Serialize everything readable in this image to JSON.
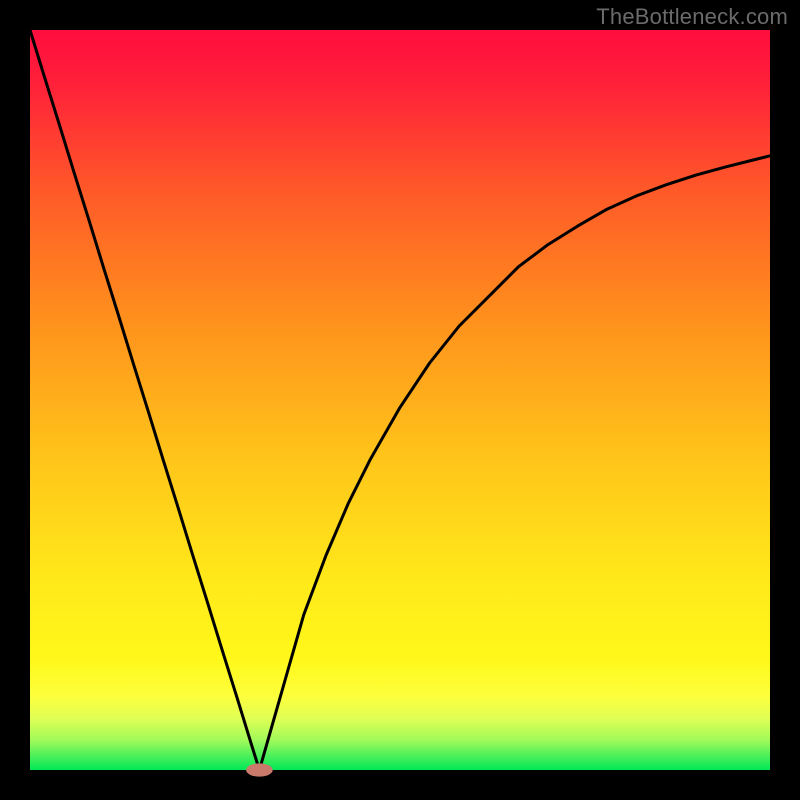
{
  "watermark": "TheBottleneck.com",
  "chart_data": {
    "type": "line",
    "title": "",
    "xlabel": "",
    "ylabel": "",
    "xlim": [
      0,
      100
    ],
    "ylim": [
      0,
      100
    ],
    "grid": false,
    "background_gradient": {
      "top_color": "#ff0d3d",
      "mid_colors": [
        "#ff7a1d",
        "#ffd21a",
        "#fff51a"
      ],
      "bottom_color": "#00e858"
    },
    "vertex": {
      "x": 31,
      "y": 0
    },
    "marker": {
      "x": 31,
      "y": 0,
      "color": "#c97a6a",
      "rx": 1.8,
      "ry": 0.9
    },
    "series": [
      {
        "name": "left-branch",
        "x": [
          0,
          2,
          4,
          6,
          8,
          10,
          12,
          14,
          16,
          18,
          20,
          22,
          24,
          26,
          28,
          30,
          31
        ],
        "y": [
          100,
          93.5,
          87.1,
          80.6,
          74.2,
          67.7,
          61.3,
          54.8,
          48.4,
          41.9,
          35.5,
          29.0,
          22.6,
          16.1,
          9.7,
          3.2,
          0
        ]
      },
      {
        "name": "right-branch",
        "x": [
          31,
          33,
          35,
          37,
          40,
          43,
          46,
          50,
          54,
          58,
          62,
          66,
          70,
          74,
          78,
          82,
          86,
          90,
          94,
          98,
          100
        ],
        "y": [
          0,
          7,
          14,
          21,
          29,
          36,
          42,
          49,
          55,
          60,
          64,
          68,
          71,
          73.5,
          75.8,
          77.6,
          79.1,
          80.4,
          81.5,
          82.5,
          83
        ]
      }
    ]
  }
}
